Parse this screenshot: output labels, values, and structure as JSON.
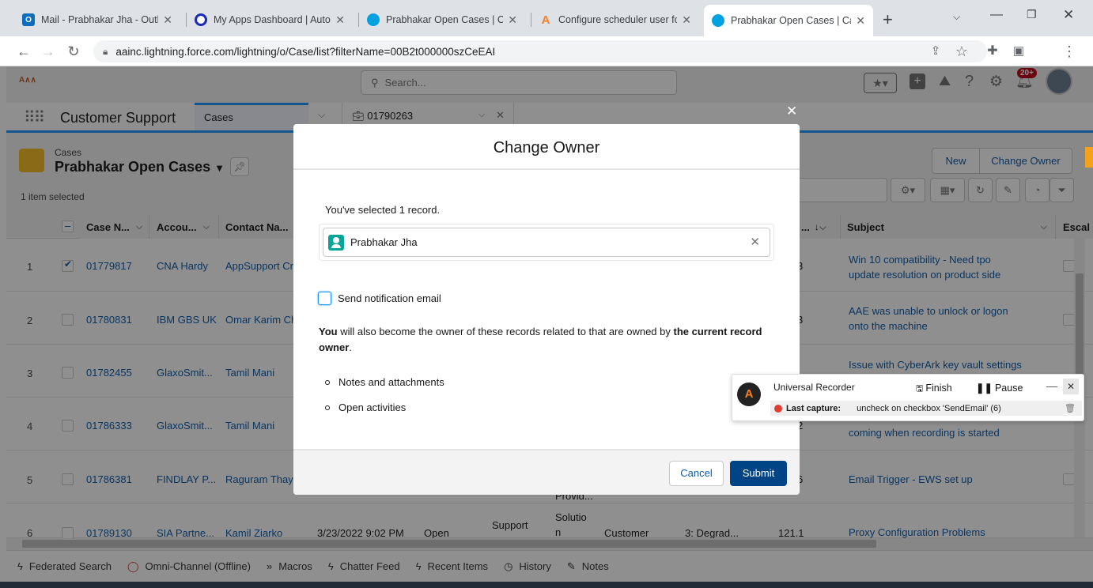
{
  "browser": {
    "tabs": [
      {
        "title": "Mail - Prabhakar Jha - Outlook",
        "icon": "outlook-icon",
        "color": "#0f6cbd"
      },
      {
        "title": "My Apps Dashboard | Automation Anywhere",
        "icon": "okta-icon",
        "color": "#1a2bb5"
      },
      {
        "title": "Prabhakar Open Cases | Cases",
        "icon": "salesforce-cloud-icon",
        "color": "#00a1e0"
      },
      {
        "title": "Configure scheduler user for",
        "icon": "automation-anywhere-icon",
        "color": "#f58025"
      },
      {
        "title": "Prabhakar Open Cases | Cases",
        "icon": "salesforce-cloud-icon",
        "color": "#00a1e0"
      }
    ],
    "url": "aainc.lightning.force.com/lightning/o/Case/list?filterName=00B2t000000szCeEAI"
  },
  "sf": {
    "search_placeholder": "Search...",
    "notification_badge": "20+",
    "app_name": "Customer Support",
    "nav_tabs": [
      {
        "label": "Cases"
      },
      {
        "label": "01790263"
      }
    ],
    "object_label": "Cases",
    "list_view_name": "Prabhakar Open Cases",
    "selection_status": "1 item selected",
    "buttons": {
      "new": "New",
      "change_owner": "Change Owner"
    },
    "columns": [
      {
        "label": "Case N..."
      },
      {
        "label": "Accou..."
      },
      {
        "label": "Contact Na..."
      },
      {
        "label": "..."
      },
      {
        "label": "Subject"
      },
      {
        "label": "Escal"
      }
    ],
    "rows": [
      {
        "num": "1",
        "case": "01779817",
        "account": "CNA Hardy",
        "contact": "AppSupport Cr",
        "mid": "3",
        "subject1": "Win 10 compatibility - Need tpo",
        "subject2": "update resolution on product side"
      },
      {
        "num": "2",
        "case": "01780831",
        "account": "IBM GBS UK",
        "contact": "Omar Karim Ch",
        "mid": "3",
        "subject1": "AAE was unable to unlock or logon",
        "subject2": "onto the machine"
      },
      {
        "num": "3",
        "case": "01782455",
        "account": "GlaxoSmit...",
        "contact": "Tamil Mani",
        "mid": "",
        "subject1": "Issue with CyberArk key vault settings",
        "subject2": ""
      },
      {
        "num": "4",
        "case": "01786333",
        "account": "GlaxoSmit...",
        "contact": "Tamil Mani",
        "mid": "2",
        "subject1": "",
        "subject2": "coming when recording is started"
      },
      {
        "num": "5",
        "case": "01786381",
        "account": "FINDLAY P...",
        "contact": "Raguram Thaya",
        "mid": "6",
        "subject1": "Email Trigger - EWS set up",
        "subject2": ""
      },
      {
        "num": "6",
        "case": "01789130",
        "account": "SIA Partne...",
        "contact": "Kamil Ziarko",
        "date": "3/23/2022 9:02 PM",
        "status": "Open",
        "origin": "Support",
        "type": "Solutio",
        "type2": "n",
        "contact_type": "Customer",
        "severity": "3: Degrad...",
        "version": "121.1",
        "subject1": "Proxy Configuration Problems",
        "subject2": ""
      }
    ],
    "row5_extra": "Provid..."
  },
  "modal": {
    "title": "Change Owner",
    "selected_text": "You've selected 1 record.",
    "owner_value": "Prabhakar Jha",
    "notify_label": "Send notification email",
    "notify_checked": false,
    "info_bold1": "You",
    "info_mid": " will also become the owner of these records related to that are owned by ",
    "info_bold2": "the current record owner",
    "info_end": ".",
    "bullets": [
      "Notes and attachments",
      "Open activities"
    ],
    "cancel": "Cancel",
    "submit": "Submit"
  },
  "recorder": {
    "title": "Universal Recorder",
    "finish": "Finish",
    "pause": "Pause",
    "last_capture_label": "Last capture:",
    "last_capture_value": "uncheck on checkbox 'SendEmail' (6)"
  },
  "utility": [
    {
      "label": "Federated Search",
      "icon": "bolt-icon"
    },
    {
      "label": "Omni-Channel (Offline)",
      "icon": "omni-channel-icon"
    },
    {
      "label": "Macros",
      "icon": "macros-icon"
    },
    {
      "label": "Chatter Feed",
      "icon": "bolt-icon"
    },
    {
      "label": "Recent Items",
      "icon": "bolt-icon"
    },
    {
      "label": "History",
      "icon": "clock-icon"
    },
    {
      "label": "Notes",
      "icon": "notes-icon"
    }
  ],
  "colors": {
    "brand": "#0b5cab",
    "submit_bg": "#014486",
    "nav_accent": "#1b96ff"
  }
}
